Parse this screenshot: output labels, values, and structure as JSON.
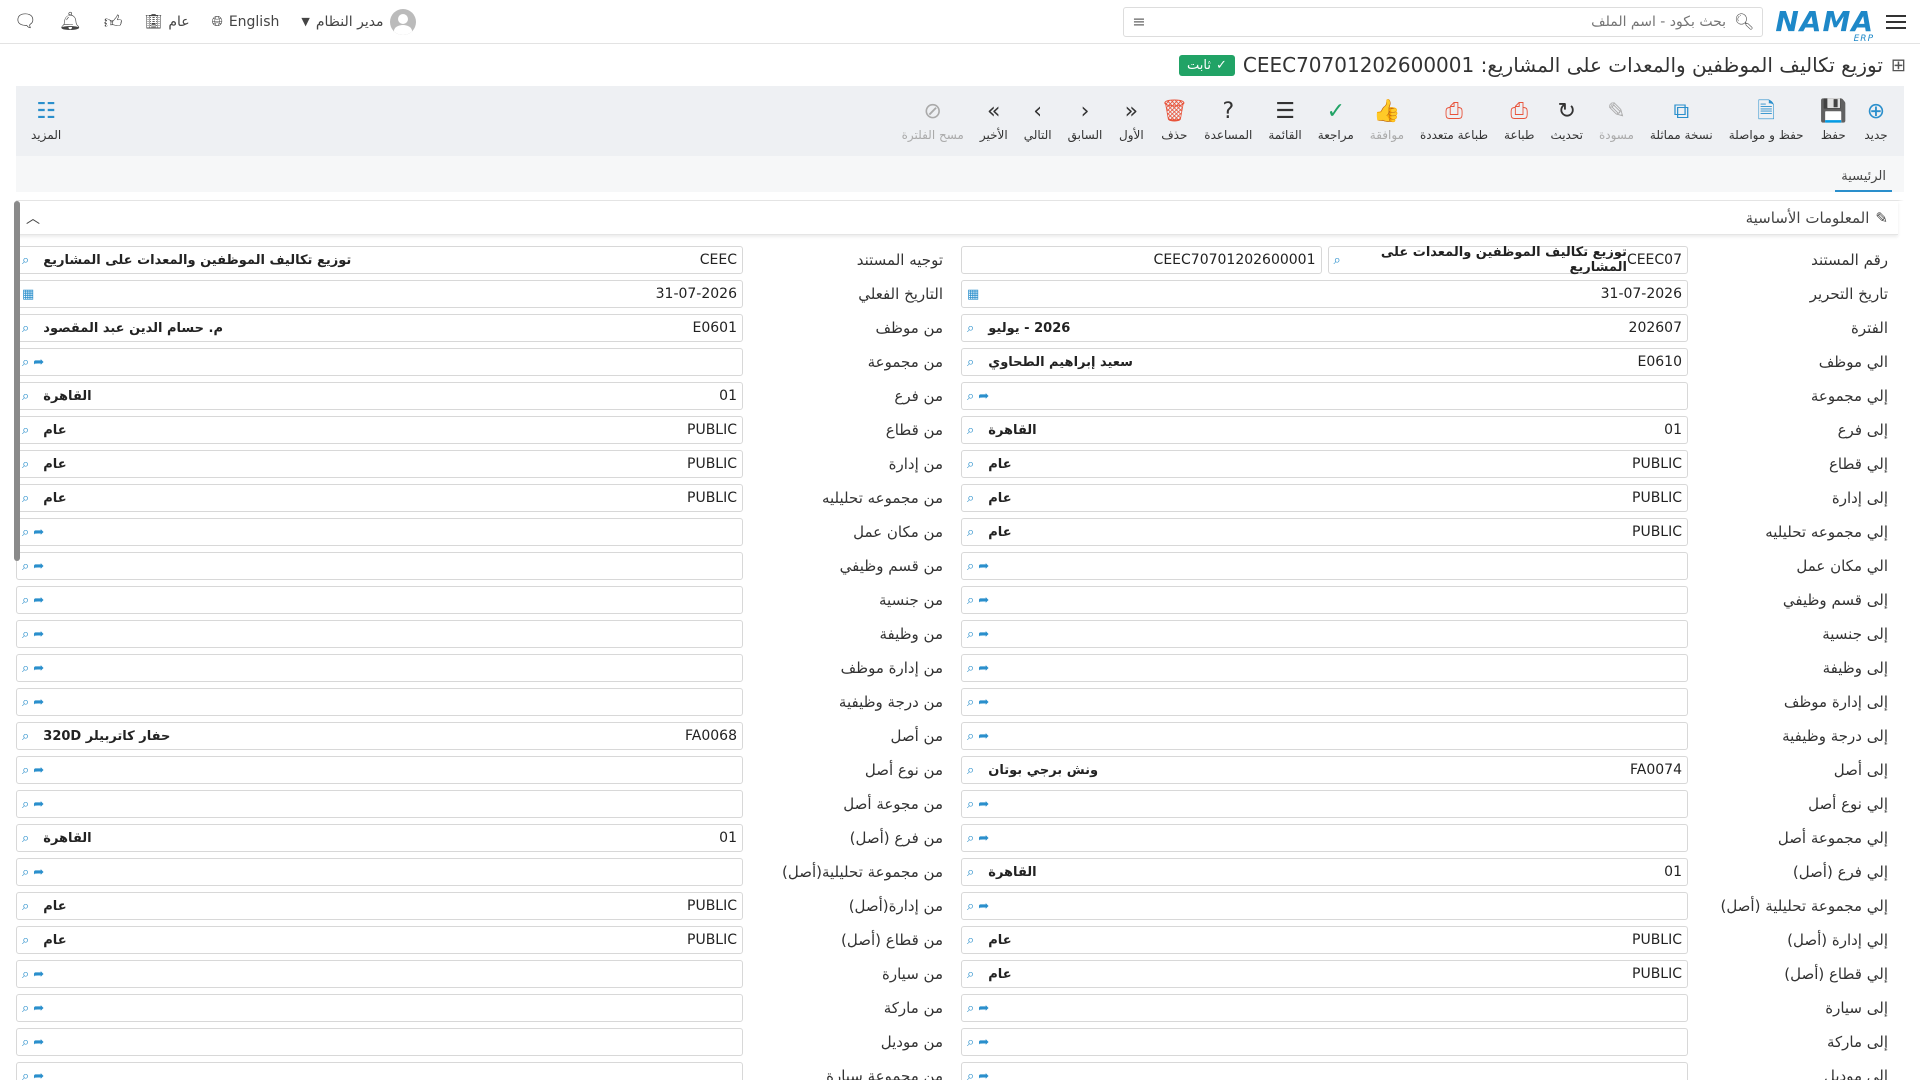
{
  "header": {
    "logo": "NAMA",
    "logo_sub": "ERP",
    "search_placeholder": "بحث بكود - اسم الملف",
    "user_name": "مدير النظام",
    "language": "English",
    "scope": "عام"
  },
  "title": {
    "text": "توزيع تكاليف الموظفين والمعدات على المشاريع: CEEC70701202600001",
    "status": "ثابت"
  },
  "toolbar": {
    "more_label": "المزيد",
    "tools": [
      {
        "label": "جديد",
        "icon": "plus-circle-icon",
        "glyph": "⊕",
        "color": "#2a8fcc",
        "disabled": false
      },
      {
        "label": "حفظ",
        "icon": "save-icon",
        "glyph": "💾",
        "color": "#2a8fcc",
        "disabled": false
      },
      {
        "label": "حفظ و مواصلة",
        "icon": "save-continue-icon",
        "glyph": "🗎",
        "color": "#2a8fcc",
        "disabled": false
      },
      {
        "label": "نسخة مماثلة",
        "icon": "copy-icon",
        "glyph": "⧉",
        "color": "#2a8fcc",
        "disabled": false
      },
      {
        "label": "مسودة",
        "icon": "draft-icon",
        "glyph": "✎",
        "color": "#aaa",
        "disabled": true
      },
      {
        "label": "تحديث",
        "icon": "refresh-icon",
        "glyph": "↻",
        "color": "#333",
        "disabled": false
      },
      {
        "label": "طباعة",
        "icon": "print-icon",
        "glyph": "⎙",
        "color": "#e8533a",
        "disabled": false
      },
      {
        "label": "طباعة متعددة",
        "icon": "multi-print-icon",
        "glyph": "⎙",
        "color": "#e8533a",
        "disabled": false
      },
      {
        "label": "موافقة",
        "icon": "thumbs-up-icon",
        "glyph": "👍",
        "color": "#aaa",
        "disabled": true
      },
      {
        "label": "مراجعة",
        "icon": "review-icon",
        "glyph": "✓",
        "color": "#21a366",
        "disabled": false
      },
      {
        "label": "القائمة",
        "icon": "list-icon",
        "glyph": "☰",
        "color": "#333",
        "disabled": false
      },
      {
        "label": "المساعدة",
        "icon": "help-icon",
        "glyph": "?",
        "color": "#333",
        "disabled": false
      },
      {
        "label": "حذف",
        "icon": "trash-icon",
        "glyph": "🗑",
        "color": "#e8533a",
        "disabled": false
      },
      {
        "label": "الأول",
        "icon": "first-icon",
        "glyph": "«",
        "color": "#333",
        "disabled": false
      },
      {
        "label": "السابق",
        "icon": "previous-icon",
        "glyph": "‹",
        "color": "#333",
        "disabled": false
      },
      {
        "label": "التالي",
        "icon": "next-icon",
        "glyph": "›",
        "color": "#333",
        "disabled": false
      },
      {
        "label": "الأخير",
        "icon": "last-icon",
        "glyph": "»",
        "color": "#333",
        "disabled": false
      },
      {
        "label": "مسح الفلترة",
        "icon": "clear-filter-icon",
        "glyph": "⊘",
        "color": "#aaa",
        "disabled": true
      }
    ]
  },
  "tabs": {
    "main": "الرئيسية"
  },
  "section": {
    "title": "المعلومات الأساسية"
  },
  "right_column": [
    {
      "label": "رقم المستند",
      "code": "CEEC07",
      "desc": "توزيع تكاليف الموظفين والمعدات على المشاريع",
      "extra": "CEEC70701202600001",
      "type": "doc"
    },
    {
      "label": "تاريخ التحرير",
      "code": "31-07-2026",
      "desc": "",
      "type": "date"
    },
    {
      "label": "الفترة",
      "code": "202607",
      "desc": "2026 - يوليو",
      "type": "lookup"
    },
    {
      "label": "الي موظف",
      "code": "E0610",
      "desc": "سعيد إبراهيم الطحاوي",
      "type": "lookup"
    },
    {
      "label": "إلي مجموعة",
      "code": "",
      "desc": "",
      "type": "lookup"
    },
    {
      "label": "إلى فرع",
      "code": "01",
      "desc": "القاهرة",
      "type": "lookup"
    },
    {
      "label": "إلي قطاع",
      "code": "PUBLIC",
      "desc": "عام",
      "type": "lookup"
    },
    {
      "label": "إلى إدارة",
      "code": "PUBLIC",
      "desc": "عام",
      "type": "lookup"
    },
    {
      "label": "إلي مجموعه تحليليه",
      "code": "PUBLIC",
      "desc": "عام",
      "type": "lookup"
    },
    {
      "label": "الي مكان عمل",
      "code": "",
      "desc": "",
      "type": "lookup"
    },
    {
      "label": "إلى قسم وظيفي",
      "code": "",
      "desc": "",
      "type": "lookup"
    },
    {
      "label": "إلى جنسية",
      "code": "",
      "desc": "",
      "type": "lookup"
    },
    {
      "label": "إلى وظيفة",
      "code": "",
      "desc": "",
      "type": "lookup"
    },
    {
      "label": "إلى إدارة موظف",
      "code": "",
      "desc": "",
      "type": "lookup"
    },
    {
      "label": "إلى درجة وظيفية",
      "code": "",
      "desc": "",
      "type": "lookup"
    },
    {
      "label": "إلى أصل",
      "code": "FA0074",
      "desc": "ونش برجي بوتان",
      "type": "lookup"
    },
    {
      "label": "إلي نوع أصل",
      "code": "",
      "desc": "",
      "type": "lookup"
    },
    {
      "label": "إلي مجموعة أصل",
      "code": "",
      "desc": "",
      "type": "lookup"
    },
    {
      "label": "إلي فرع (أصل)",
      "code": "01",
      "desc": "القاهرة",
      "type": "lookup"
    },
    {
      "label": "إلي مجموعة تحليلية (أصل)",
      "code": "",
      "desc": "",
      "type": "lookup"
    },
    {
      "label": "إلي إدارة (أصل)",
      "code": "PUBLIC",
      "desc": "عام",
      "type": "lookup"
    },
    {
      "label": "إلي قطاع (أصل)",
      "code": "PUBLIC",
      "desc": "عام",
      "type": "lookup"
    },
    {
      "label": "إلى سيارة",
      "code": "",
      "desc": "",
      "type": "lookup"
    },
    {
      "label": "إلى ماركة",
      "code": "",
      "desc": "",
      "type": "lookup"
    },
    {
      "label": "الي موديل",
      "code": "",
      "desc": "",
      "type": "lookup"
    }
  ],
  "left_column": [
    {
      "label": "توجيه المستند",
      "code": "CEEC",
      "desc": "توزيع تكاليف الموظفين والمعدات على المشاريع",
      "type": "lookup"
    },
    {
      "label": "التاريخ الفعلي",
      "code": "31-07-2026",
      "desc": "",
      "type": "date"
    },
    {
      "label": "من موظف",
      "code": "E0601",
      "desc": "م. حسام الدين عبد المقصود",
      "type": "lookup"
    },
    {
      "label": "من مجموعة",
      "code": "",
      "desc": "",
      "type": "lookup"
    },
    {
      "label": "من فرع",
      "code": "01",
      "desc": "القاهرة",
      "type": "lookup"
    },
    {
      "label": "من قطاع",
      "code": "PUBLIC",
      "desc": "عام",
      "type": "lookup"
    },
    {
      "label": "من إدارة",
      "code": "PUBLIC",
      "desc": "عام",
      "type": "lookup"
    },
    {
      "label": "من مجموعه تحليليه",
      "code": "PUBLIC",
      "desc": "عام",
      "type": "lookup"
    },
    {
      "label": "من مكان عمل",
      "code": "",
      "desc": "",
      "type": "lookup"
    },
    {
      "label": "من قسم وظيفي",
      "code": "",
      "desc": "",
      "type": "lookup"
    },
    {
      "label": "من جنسية",
      "code": "",
      "desc": "",
      "type": "lookup"
    },
    {
      "label": "من وظيفة",
      "code": "",
      "desc": "",
      "type": "lookup"
    },
    {
      "label": "من إدارة موظف",
      "code": "",
      "desc": "",
      "type": "lookup"
    },
    {
      "label": "من درجة وظيفية",
      "code": "",
      "desc": "",
      "type": "lookup"
    },
    {
      "label": "من أصل",
      "code": "FA0068",
      "desc": "حفار كاتربيلر 320D",
      "type": "lookup"
    },
    {
      "label": "من نوع أصل",
      "code": "",
      "desc": "",
      "type": "lookup"
    },
    {
      "label": "من مجوعة أصل",
      "code": "",
      "desc": "",
      "type": "lookup"
    },
    {
      "label": "من فرع (أصل)",
      "code": "01",
      "desc": "القاهرة",
      "type": "lookup"
    },
    {
      "label": "من مجموعة تحليلية(أصل)",
      "code": "",
      "desc": "",
      "type": "lookup"
    },
    {
      "label": "من إدارة(أصل)",
      "code": "PUBLIC",
      "desc": "عام",
      "type": "lookup"
    },
    {
      "label": "من قطاع (أصل)",
      "code": "PUBLIC",
      "desc": "عام",
      "type": "lookup"
    },
    {
      "label": "من سيارة",
      "code": "",
      "desc": "",
      "type": "lookup"
    },
    {
      "label": "من ماركة",
      "code": "",
      "desc": "",
      "type": "lookup"
    },
    {
      "label": "من موديل",
      "code": "",
      "desc": "",
      "type": "lookup"
    },
    {
      "label": "من مجموعة سيارة",
      "code": "",
      "desc": "",
      "type": "lookup"
    }
  ]
}
